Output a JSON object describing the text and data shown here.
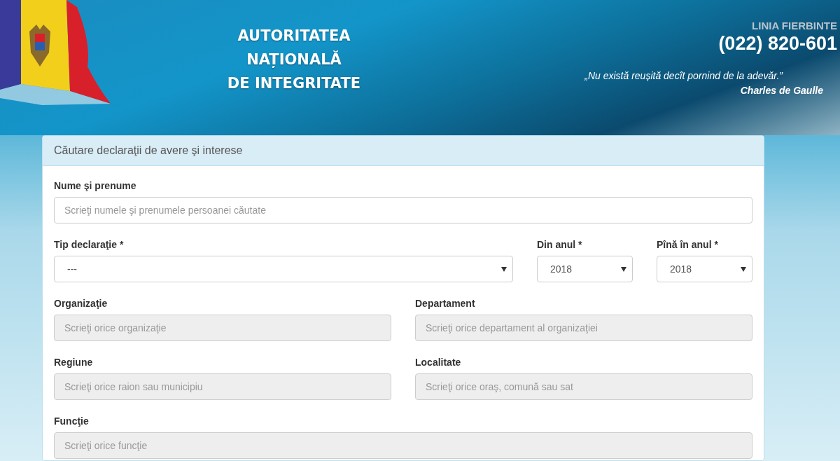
{
  "header": {
    "title": "AUTORITATEA\nNAȚIONALĂ\nDE INTEGRITATE",
    "hotline_label": "LINIA FIERBINTE",
    "hotline_phone": "(022) 820-601",
    "quote": "„Nu există reușită decît pornind de la adevăr.”",
    "quote_author": "Charles de Gaulle"
  },
  "panel": {
    "title": "Căutare declaraţii de avere şi interese",
    "rows": [
      [
        {
          "label": "Nume şi prenume",
          "kind": "text",
          "placeholder": "Scrieţi numele şi prenumele persoanei căutate",
          "disabled": false
        }
      ],
      [
        {
          "label": "Tip declaraţie *",
          "kind": "select",
          "value": "---",
          "disabled": false
        },
        {
          "label": "Din anul *",
          "kind": "select",
          "value": "2018",
          "disabled": false
        },
        {
          "label": "Pînă în anul *",
          "kind": "select",
          "value": "2018",
          "disabled": false
        }
      ],
      [
        {
          "label": "Organizaţie",
          "kind": "text",
          "placeholder": "Scrieţi orice organizaţie",
          "disabled": true
        },
        {
          "label": "Departament",
          "kind": "text",
          "placeholder": "Scrieţi orice departament al organizaţiei",
          "disabled": true
        }
      ],
      [
        {
          "label": "Regiune",
          "kind": "text",
          "placeholder": "Scrieţi orice raion sau municipiu",
          "disabled": true
        },
        {
          "label": "Localitate",
          "kind": "text",
          "placeholder": "Scrieţi orice oraş, comună sau sat",
          "disabled": true
        }
      ],
      [
        {
          "label": "Funcţie",
          "kind": "text",
          "placeholder": "Scrieţi orice funcţie",
          "disabled": true
        }
      ]
    ]
  }
}
